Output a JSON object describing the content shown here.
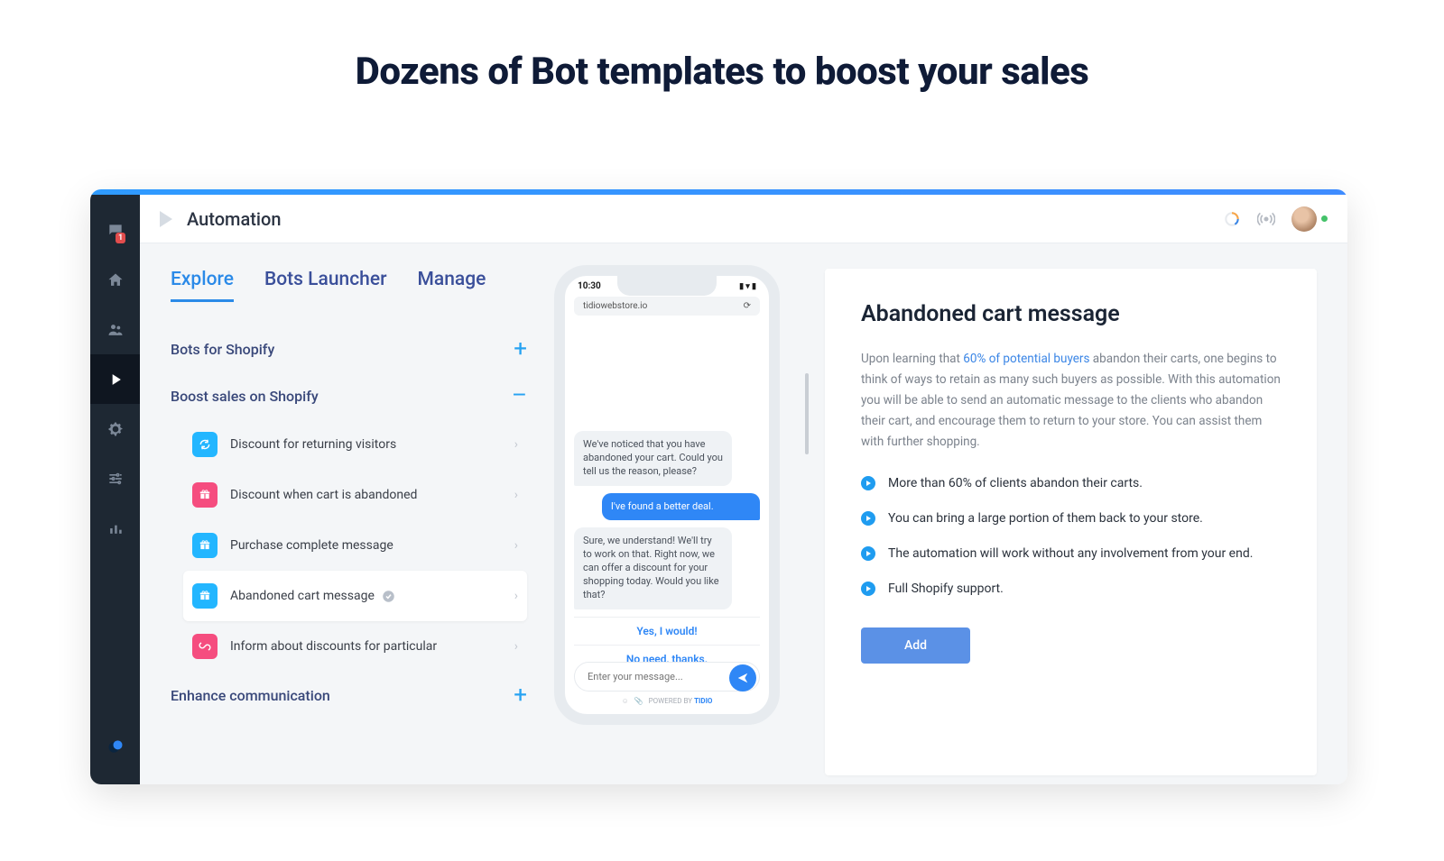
{
  "marketing_headline": "Dozens of Bot templates to boost your sales",
  "header": {
    "title": "Automation"
  },
  "sidebar": {
    "notif_badge": "1"
  },
  "tabs": {
    "explore": "Explore",
    "launcher": "Bots Launcher",
    "manage": "Manage"
  },
  "sections": {
    "shopify": {
      "label": "Bots for Shopify",
      "toggle": "+"
    },
    "boost": {
      "label": "Boost sales on Shopify",
      "toggle": "–"
    },
    "enhance": {
      "label": "Enhance communication",
      "toggle": "+"
    },
    "items": [
      {
        "label": "Discount for returning visitors",
        "color": "blue",
        "icon": "refresh"
      },
      {
        "label": "Discount when cart is abandoned",
        "color": "pink",
        "icon": "gift"
      },
      {
        "label": "Purchase complete message",
        "color": "blue",
        "icon": "gift"
      },
      {
        "label": "Abandoned cart message",
        "color": "blue",
        "icon": "gift",
        "selected": true
      },
      {
        "label": "Inform about discounts for particular",
        "color": "pink",
        "icon": "link"
      }
    ]
  },
  "phone": {
    "time": "10:30",
    "url": "tidiowebstore.io",
    "bot1": "We've noticed that you have abandoned your cart. Could you tell us the reason, please?",
    "user1": "I've found  a better deal.",
    "bot2": "Sure, we understand! We'll try to work on that. Right now, we can offer a discount for your shopping today. Would you like that?",
    "quick1": "Yes, I would!",
    "quick2": "No need, thanks.",
    "placeholder": "Enter your message...",
    "powered_prefix": "POWERED BY ",
    "powered_brand": "TIDIO"
  },
  "detail": {
    "title": "Abandoned cart message",
    "p_before": "Upon learning that ",
    "p_link": "60% of potential buyers",
    "p_after": " abandon their carts, one begins to think of ways to retain as many such buyers as possible. With this automation you will be able to send an automatic message to the clients who abandon their cart, and encourage them to return to your store. You can assist them with further shopping.",
    "bullets": [
      "More than 60% of clients abandon their carts.",
      "You can bring a large portion of them back to your store.",
      "The automation will work without any involvement from your end.",
      "Full Shopify support."
    ],
    "add": "Add"
  }
}
